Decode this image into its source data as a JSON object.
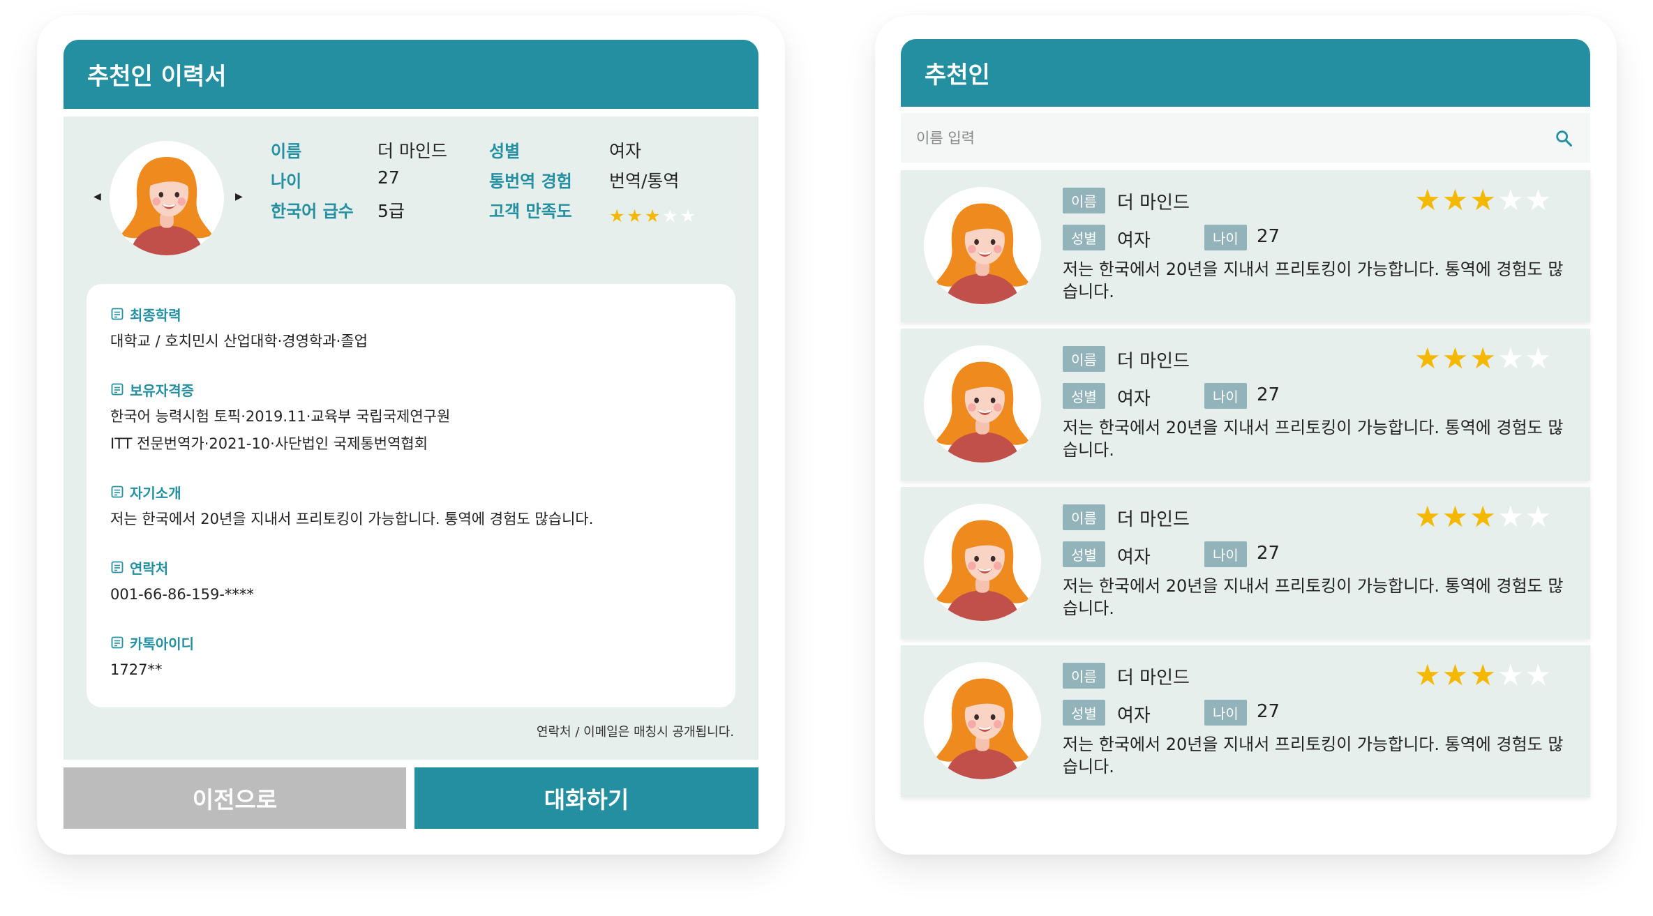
{
  "left": {
    "title": "추천인 이력서",
    "profile": {
      "labels": {
        "name": "이름",
        "age": "나이",
        "korean_level": "한국어 급수",
        "gender": "성별",
        "experience": "통번역 경험",
        "satisfaction": "고객 만족도"
      },
      "values": {
        "name": "더 마인드",
        "age": "27",
        "korean_level": "5급",
        "gender": "여자",
        "experience": "번역/통역"
      },
      "satisfaction_rating": 3,
      "satisfaction_max": 5
    },
    "sections": {
      "education": {
        "title": "최종학력",
        "lines": [
          "대학교 / 호치민시 산업대학·경영학과·졸업"
        ]
      },
      "certificates": {
        "title": "보유자격증",
        "lines": [
          "한국어 능력시험 토픽·2019.11·교육부 국립국제연구원",
          "ITT 전문번역가·2021-10·사단법인 국제통번역협회"
        ]
      },
      "intro": {
        "title": "자기소개",
        "lines": [
          "저는 한국에서 20년을 지내서 프리토킹이 가능합니다. 통역에 경험도 많습니다."
        ]
      },
      "contact": {
        "title": "연락처",
        "lines": [
          "001-66-86-159-****"
        ]
      },
      "kakao": {
        "title": "카톡아이디",
        "lines": [
          "1727**"
        ]
      }
    },
    "note": "연락처 / 이메일은 매칭시 공개됩니다.",
    "buttons": {
      "prev": "이전으로",
      "chat": "대화하기"
    }
  },
  "right": {
    "title": "추천인",
    "search": {
      "placeholder": "이름 입력",
      "value": ""
    },
    "tags": {
      "name": "이름",
      "gender": "성별",
      "age": "나이"
    },
    "recommenders": [
      {
        "name": "더 마인드",
        "gender": "여자",
        "age": "27",
        "rating": 3,
        "intro": "저는 한국에서 20년을 지내서 프리토킹이 가능합니다. 통역에 경험도 많습니다."
      },
      {
        "name": "더 마인드",
        "gender": "여자",
        "age": "27",
        "rating": 3,
        "intro": "저는 한국에서 20년을 지내서 프리토킹이 가능합니다. 통역에 경험도 많습니다."
      },
      {
        "name": "더 마인드",
        "gender": "여자",
        "age": "27",
        "rating": 3,
        "intro": "저는 한국에서 20년을 지내서 프리토킹이 가능합니다. 통역에 경험도 많습니다."
      },
      {
        "name": "더 마인드",
        "gender": "여자",
        "age": "27",
        "rating": 3,
        "intro": "저는 한국에서 20년을 지내서 프리토킹이 가능합니다. 통역에 경험도 많습니다."
      }
    ]
  },
  "colors": {
    "accent": "#238fa0",
    "panel_bg": "#e6efec",
    "tag_bg": "#93b3ba",
    "star": "#f5b800",
    "disabled_button": "#bcbcbc"
  },
  "icons": {
    "section": "note-icon",
    "search": "search-icon",
    "prev": "caret-left-icon",
    "next": "caret-right-icon"
  }
}
